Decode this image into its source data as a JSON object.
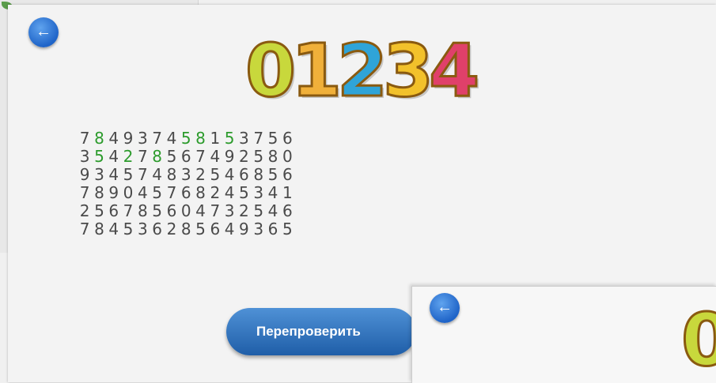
{
  "logo": {
    "digits": [
      {
        "char": "0",
        "color": "#c8d83c"
      },
      {
        "char": "1",
        "color": "#f0b03a"
      },
      {
        "char": "2",
        "color": "#2fa4d8"
      },
      {
        "char": "3",
        "color": "#f2c12b"
      },
      {
        "char": "4",
        "color": "#e0406a"
      }
    ]
  },
  "grid": {
    "highlight_color": "#2c9b2c",
    "rows": [
      [
        "7",
        "8",
        "4",
        "9",
        "3",
        "7",
        "4",
        "5",
        "8",
        "1",
        "5",
        "3",
        "7",
        "5",
        "6"
      ],
      [
        "3",
        "5",
        "4",
        "2",
        "7",
        "8",
        "5",
        "6",
        "7",
        "4",
        "9",
        "2",
        "5",
        "8",
        "0"
      ],
      [
        "9",
        "3",
        "4",
        "5",
        "7",
        "4",
        "8",
        "3",
        "2",
        "5",
        "4",
        "6",
        "8",
        "5",
        "6"
      ],
      [
        "7",
        "8",
        "9",
        "0",
        "4",
        "5",
        "7",
        "6",
        "8",
        "2",
        "4",
        "5",
        "3",
        "4",
        "1"
      ],
      [
        "2",
        "5",
        "6",
        "7",
        "8",
        "5",
        "6",
        "0",
        "4",
        "7",
        "3",
        "2",
        "5",
        "4",
        "6"
      ],
      [
        "7",
        "8",
        "4",
        "5",
        "3",
        "6",
        "2",
        "8",
        "5",
        "6",
        "4",
        "9",
        "3",
        "6",
        "5"
      ]
    ],
    "highlighted": [
      [
        0,
        1
      ],
      [
        0,
        7
      ],
      [
        0,
        8
      ],
      [
        0,
        10
      ],
      [
        1,
        1
      ],
      [
        1,
        3
      ],
      [
        1,
        5
      ]
    ]
  },
  "buttons": {
    "recheck_label": "Перепроверить",
    "back_icon": "arrow-left-icon"
  },
  "duplicate_panel": {
    "logo_char": "0",
    "logo_color": "#c8d83c"
  }
}
